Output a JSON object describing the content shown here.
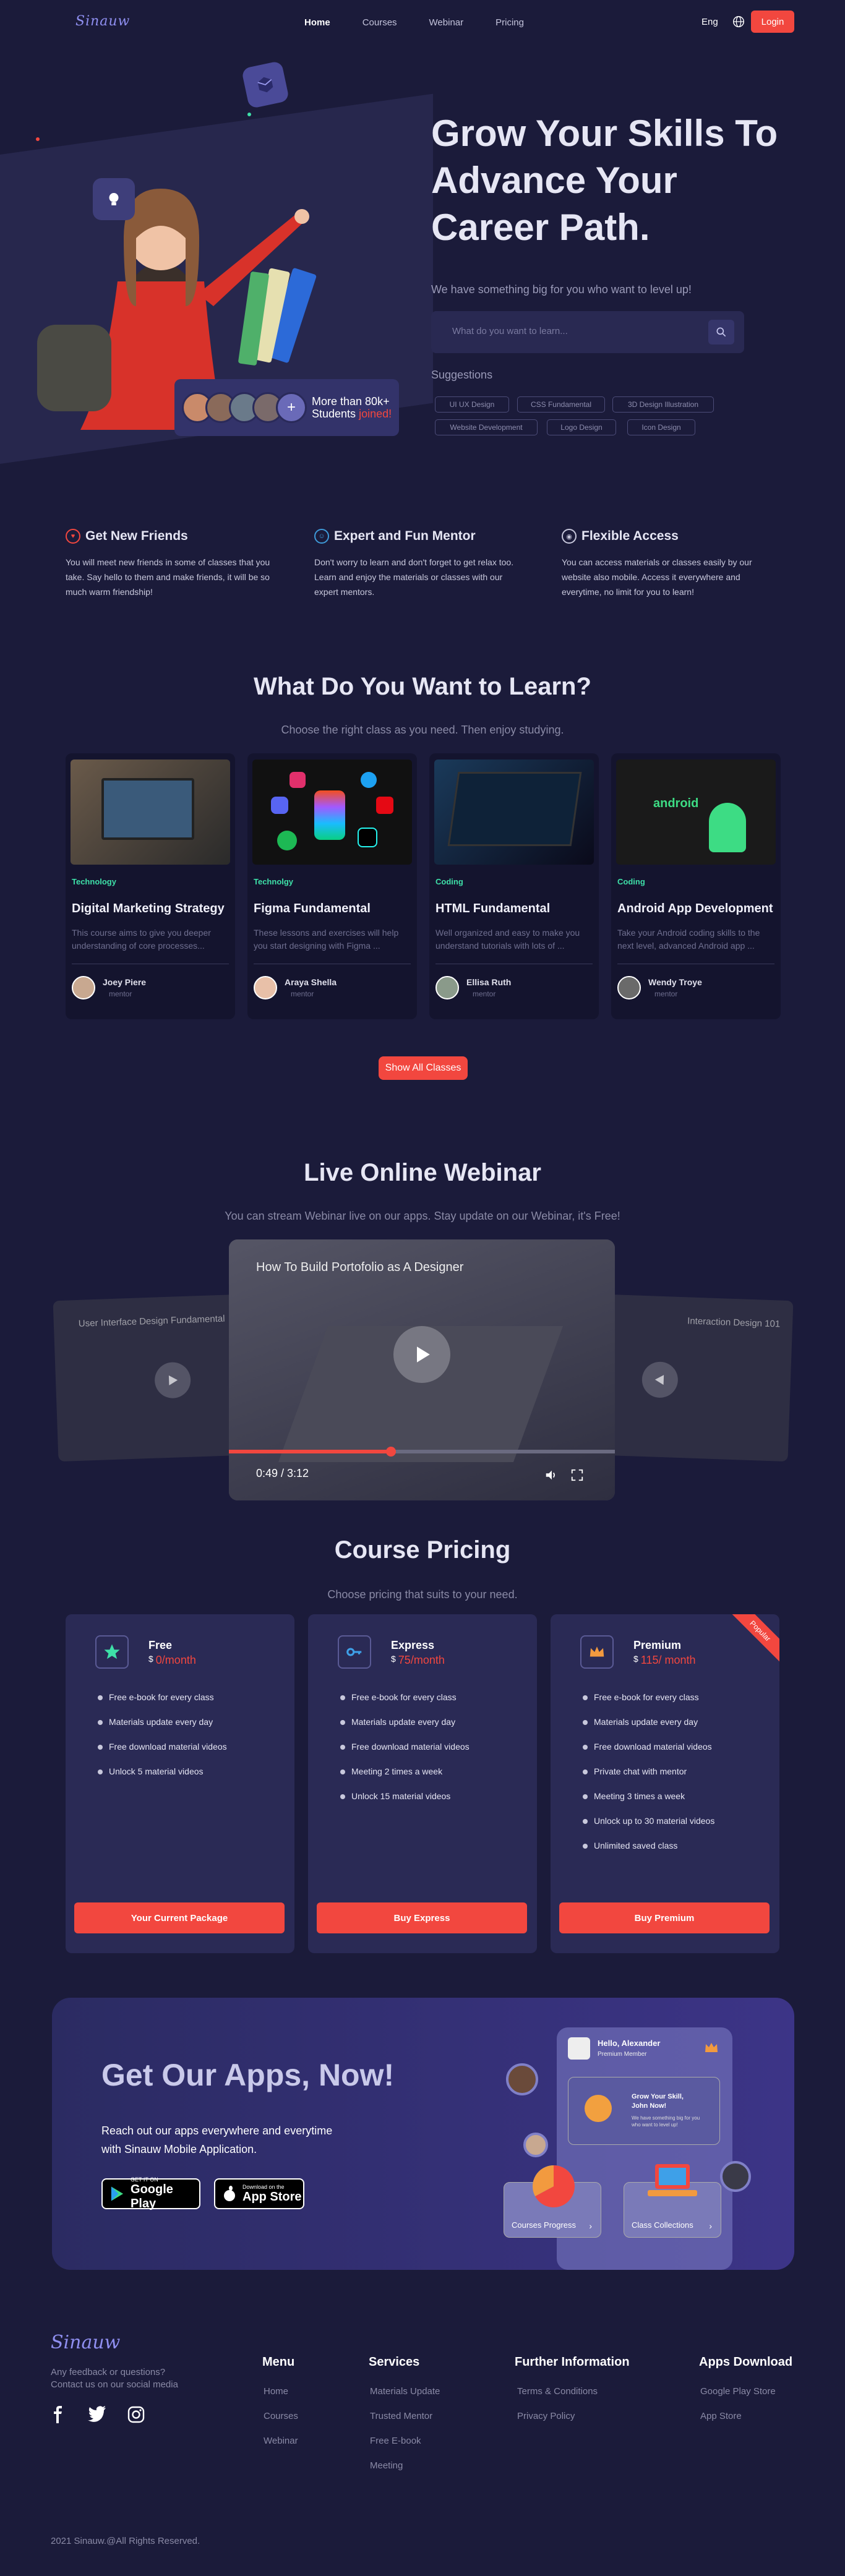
{
  "nav": {
    "logo": "Sinauw",
    "links": [
      "Home",
      "Courses",
      "Webinar",
      "Pricing"
    ],
    "lang": "Eng",
    "login": "Login"
  },
  "hero": {
    "title_1": "Grow Your Skills To",
    "title_2": "Advance Your",
    "title_3": "Career Path.",
    "subtitle": "We have something big for you who want to level up!",
    "search_placeholder": "What do you want to learn...",
    "suggestions_title": "Suggestions",
    "suggestions": [
      "UI UX Design",
      "CSS Fundamental",
      "3D Design Illustration",
      "Website Development",
      "Logo Design",
      "Icon Design"
    ],
    "students_line1": "More than 80k+",
    "students_line2": "Students",
    "students_highlight": "joined!"
  },
  "features": [
    {
      "title": "Get New Friends",
      "body": "You will meet new friends in some of classes that you take. Say hello to them and make friends, it will be so much warm friendship!"
    },
    {
      "title": "Expert and Fun Mentor",
      "body": "Don't worry to learn and don't forget to get relax too. Learn and enjoy the materials or classes with our expert mentors."
    },
    {
      "title": "Flexible Access",
      "body": "You can access materials or classes easily by our website also mobile. Access it everywhere and everytime, no limit for you to learn!"
    }
  ],
  "learn": {
    "title": "What Do You Want to Learn?",
    "subtitle": "Choose the right class as you need. Then enjoy studying.",
    "show_all": "Show All Classes",
    "courses": [
      {
        "tag": "Technology",
        "title": "Digital Marketing Strategy",
        "desc_1": "This course aims to give you deeper",
        "desc_2": "understanding of core processes...",
        "mentor": "Joey Piere",
        "role": "mentor"
      },
      {
        "tag": "Technolgy",
        "title": "Figma Fundamental",
        "desc_1": "These lessons and exercises will help",
        "desc_2": "you start designing with Figma ...",
        "mentor": "Araya Shella",
        "role": "mentor"
      },
      {
        "tag": "Coding",
        "title": "HTML Fundamental",
        "desc_1": "Well organized and easy to make you",
        "desc_2": "understand tutorials with lots of ...",
        "mentor": "Ellisa Ruth",
        "role": "mentor"
      },
      {
        "tag": "Coding",
        "title": "Android App Development",
        "desc_1": "Take your Android coding skills to the",
        "desc_2": "next level, advanced Android app ...",
        "mentor": "Wendy Troye",
        "role": "mentor"
      }
    ]
  },
  "webinar": {
    "title": "Live Online Webinar",
    "subtitle": "You can stream Webinar live on our apps. Stay update on our Webinar, it's Free!",
    "video_title": "How To Build Portofolio as A Designer",
    "left_title": "User Interface Design Fundamental",
    "right_title": "Interaction Design 101",
    "time": "0:49 / 3:12",
    "progress": 0.42
  },
  "pricing": {
    "title": "Course Pricing",
    "subtitle": "Choose pricing that suits to your need.",
    "plans": [
      {
        "name": "Free",
        "currency": "$",
        "price": "0/month",
        "features": [
          "Free e-book for every class",
          "Materials update every day",
          "Free download material videos",
          "Unlock 5 material videos"
        ],
        "button": "Your Current Package"
      },
      {
        "name": "Express",
        "currency": "$",
        "price": "75/month",
        "features": [
          "Free e-book for every class",
          "Materials update every day",
          "Free download material videos",
          "Meeting 2 times a week",
          "Unlock 15 material videos"
        ],
        "button": "Buy Express"
      },
      {
        "name": "Premium",
        "currency": "$",
        "price": "115/ month",
        "features": [
          "Free e-book for every class",
          "Materials update every day",
          "Free download material videos",
          "Private chat with mentor",
          "Meeting 3 times a week",
          "Unlock up to 30 material videos",
          "Unlimited saved class"
        ],
        "button": "Buy Premium",
        "ribbon": "Popular"
      }
    ]
  },
  "apps": {
    "title": "Get Our Apps, Now!",
    "sub_1": "Reach out our apps everywhere and everytime",
    "sub_2": "with Sinauw Mobile Application.",
    "gplay_small": "GET IT ON",
    "gplay": "Google Play",
    "appstore_small": "Download on the",
    "appstore": "App Store",
    "phone_hello": "Hello, Alexander",
    "phone_member": "Premium Member",
    "phone_card_title": "Grow Your Skill, John Now!",
    "phone_card_sub": "We have something big for you who want to level up!",
    "progress_label": "Courses Progress",
    "collections_label": "Class Collections"
  },
  "footer": {
    "logo": "Sinauw",
    "tag_1": "Any feedback or questions?",
    "tag_2": "Contact us on our social media",
    "columns": [
      {
        "title": "Menu",
        "links": [
          "Home",
          "Courses",
          "Webinar"
        ]
      },
      {
        "title": "Services",
        "links": [
          "Materials Update",
          "Trusted Mentor",
          "Free E-book",
          "Meeting"
        ]
      },
      {
        "title": "Further Information",
        "links": [
          "Terms & Conditions",
          "Privacy Policy"
        ]
      },
      {
        "title": "Apps Download",
        "links": [
          "Google Play Store",
          "App Store"
        ]
      }
    ],
    "copyright": "2021 Sinauw.@All Rights Reserved."
  },
  "colors": {
    "background": "#1b1b3a",
    "accent": "#f2473f",
    "brand": "#8f8ff0",
    "tag": "#3ee0a8"
  }
}
